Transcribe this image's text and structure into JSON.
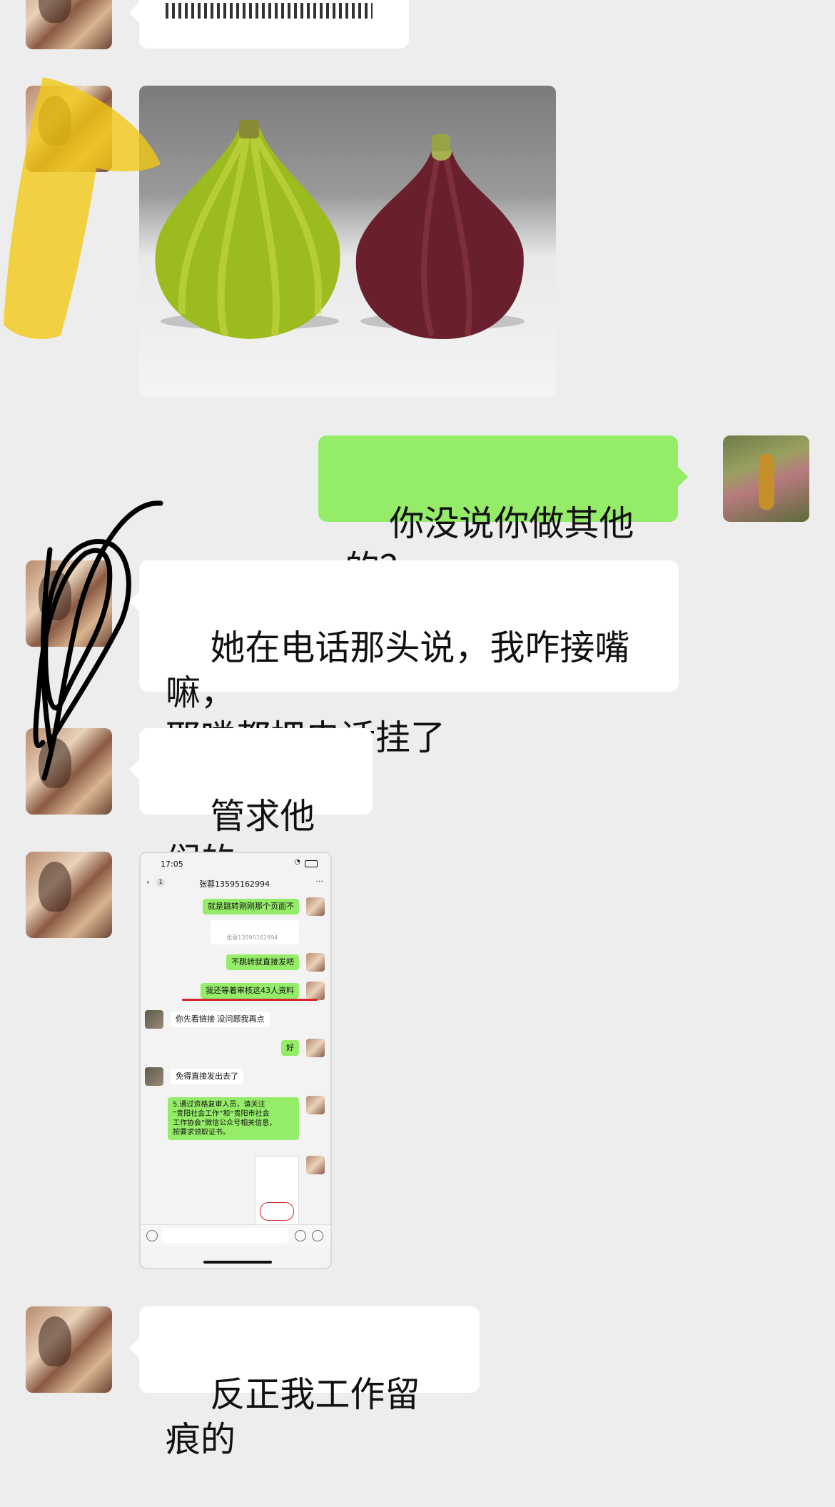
{
  "messages": [
    {
      "type": "text",
      "side": "left",
      "text": ""
    },
    {
      "type": "image",
      "side": "left",
      "image": "two-figs-photo"
    },
    {
      "type": "text",
      "side": "right",
      "text": "你没说你做其他的？"
    },
    {
      "type": "text",
      "side": "left",
      "text": "她在电话那头说，我咋接嘴嘛，\n耶喽都把电话挂了"
    },
    {
      "type": "text",
      "side": "left",
      "text": "管求他们的"
    },
    {
      "type": "image",
      "side": "left",
      "image": "chat-screenshot"
    },
    {
      "type": "text",
      "side": "left",
      "text": "反正我工作留痕的"
    }
  ],
  "nested_chat": {
    "time": "17:05",
    "back_count": "1",
    "contact": "张蓉13595162994",
    "more": "···",
    "messages": [
      {
        "side": "right",
        "text": "就是跳转刚刚那个页面不"
      },
      {
        "side": "right",
        "text": "张蓉13595162994"
      },
      {
        "side": "right",
        "text": "不跳转就直接发吧"
      },
      {
        "side": "right",
        "text": "我还等着审核这43人资料"
      },
      {
        "side": "left",
        "text": "你先看链接 没问题我再点"
      },
      {
        "side": "right",
        "text": "好"
      },
      {
        "side": "left",
        "text": "免得直接发出去了"
      },
      {
        "side": "right",
        "text": "5.通过资格复审人员，请关注\n“贵阳社会工作”和“贵阳市社会\n工作协会”微信公众号相关信息，\n按要求领取证书。"
      }
    ]
  },
  "colors": {
    "background": "#ededed",
    "bubble_self": "#95ec69",
    "bubble_other": "#ffffff",
    "highlight": "#f2c811",
    "scribble": "#000000"
  }
}
